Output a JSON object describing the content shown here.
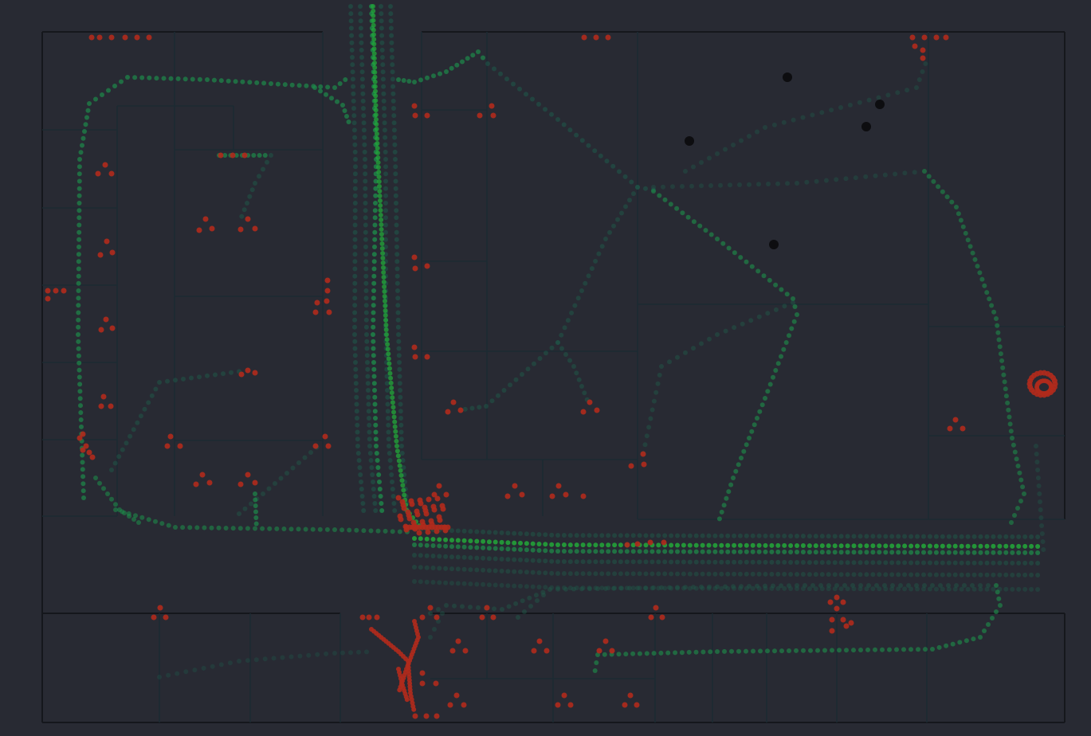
{
  "colors": {
    "background": "#282a33",
    "wall": "#15171c",
    "room_divider": "#1c2b33",
    "trail_faint": "#1e5a4a",
    "trail_mid": "#1d8a4a",
    "trail_bright": "#22a83a",
    "stop_marker": "#b02a1c",
    "landmark": "#0d0d10"
  },
  "legend": {
    "trail": "movement-trail",
    "stop": "dwell-marker",
    "landmark": "fixed-landmark"
  },
  "landmark_count": 5
}
